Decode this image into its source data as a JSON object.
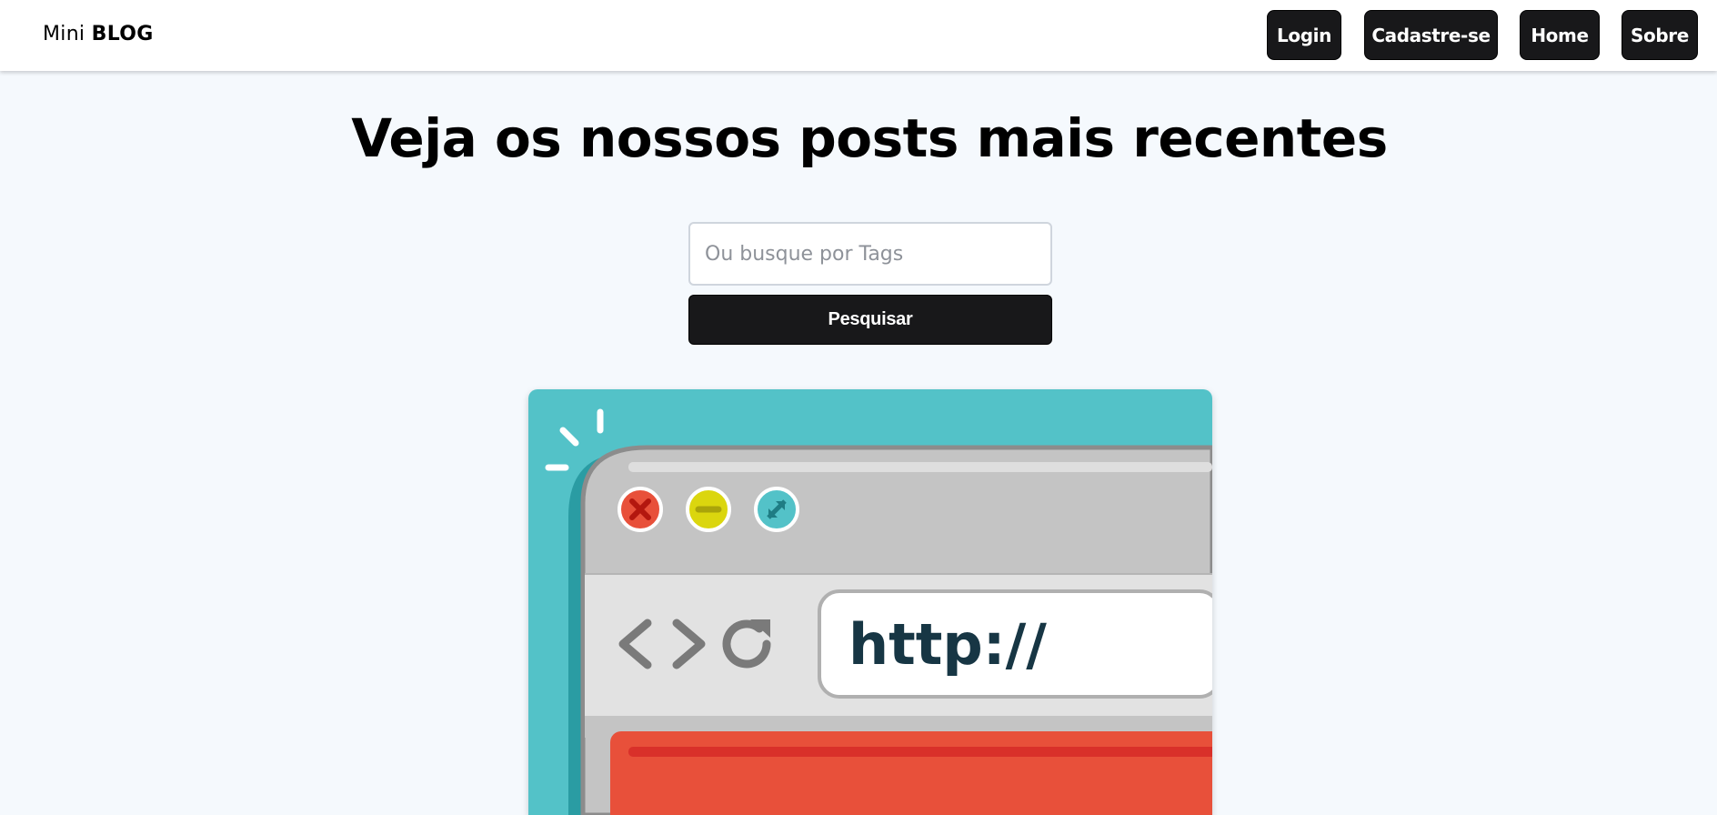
{
  "navbar": {
    "brand_light": "Mini",
    "brand_bold": "BLOG",
    "links": [
      {
        "label": "Login"
      },
      {
        "label": "Cadastre-se"
      },
      {
        "label": "Home"
      },
      {
        "label": "Sobre"
      }
    ]
  },
  "main": {
    "title": "Veja os nossos posts mais recentes",
    "search": {
      "placeholder": "Ou busque por Tags",
      "value": "",
      "button_label": "Pesquisar"
    }
  },
  "hero_image": {
    "url_text": "http://",
    "icons": [
      "close-icon",
      "minimize-icon",
      "maximize-icon",
      "back-arrow-icon",
      "forward-arrow-icon",
      "reload-icon"
    ],
    "colors": {
      "teal": "#53c2c8",
      "teal_dark": "#2a9ca3",
      "red": "#e8503a",
      "yellow": "#dbd60e",
      "url_text": "#173644"
    }
  }
}
